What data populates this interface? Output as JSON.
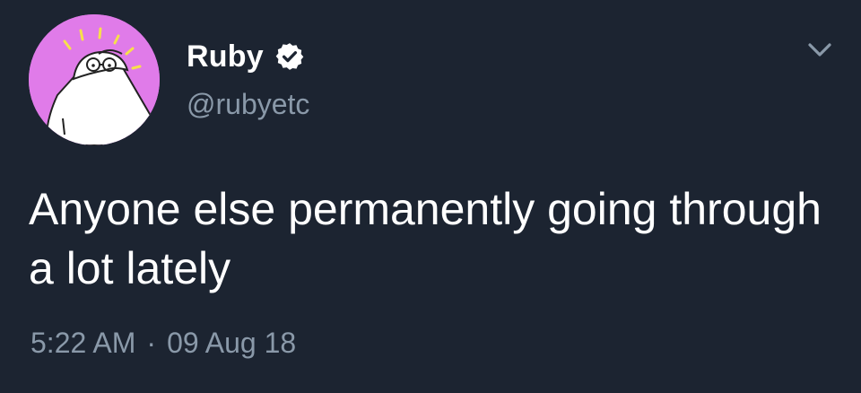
{
  "tweet": {
    "display_name": "Ruby",
    "handle": "@rubyetc",
    "text": "Anyone else permanently going through a lot lately",
    "time": "5:22 AM",
    "separator": "·",
    "date": "09 Aug 18"
  },
  "icons": {
    "verified": "verified-badge-icon",
    "menu": "chevron-down-icon"
  },
  "colors": {
    "background": "#1c2431",
    "text": "#ffffff",
    "muted": "#8a99a9",
    "avatar_bg": "#e07be9"
  }
}
